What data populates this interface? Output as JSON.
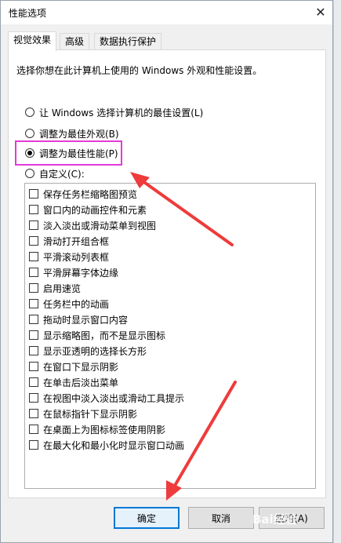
{
  "dialog": {
    "title": "性能选项",
    "close_icon": "✕"
  },
  "tabs": [
    {
      "label": "视觉效果",
      "active": true
    },
    {
      "label": "高级",
      "active": false
    },
    {
      "label": "数据执行保护",
      "active": false
    }
  ],
  "description": "选择你想在此计算机上使用的 Windows 外观和性能设置。",
  "radios": [
    {
      "label": "让 Windows 选择计算机的最佳设置(L)",
      "checked": false
    },
    {
      "label": "调整为最佳外观(B)",
      "checked": false
    },
    {
      "label": "调整为最佳性能(P)",
      "checked": true
    },
    {
      "label": "自定义(C):",
      "checked": false
    }
  ],
  "effects": [
    "保存任务栏缩略图预览",
    "窗口内的动画控件和元素",
    "淡入淡出或滑动菜单到视图",
    "滑动打开组合框",
    "平滑滚动列表框",
    "平滑屏幕字体边缘",
    "启用速览",
    "任务栏中的动画",
    "拖动时显示窗口内容",
    "显示缩略图，而不是显示图标",
    "显示亚透明的选择长方形",
    "在窗口下显示阴影",
    "在单击后淡出菜单",
    "在视图中淡入淡出或滑动工具提示",
    "在鼠标指针下显示阴影",
    "在桌面上为图标标签使用阴影",
    "在最大化和最小化时显示窗口动画"
  ],
  "buttons": {
    "ok": "确定",
    "cancel": "取消",
    "apply": "应用(A)"
  },
  "watermark": "Bai经验",
  "colors": {
    "highlight": "#e33ad7",
    "arrow": "#ee3b3b",
    "primary_border": "#0078d7"
  }
}
